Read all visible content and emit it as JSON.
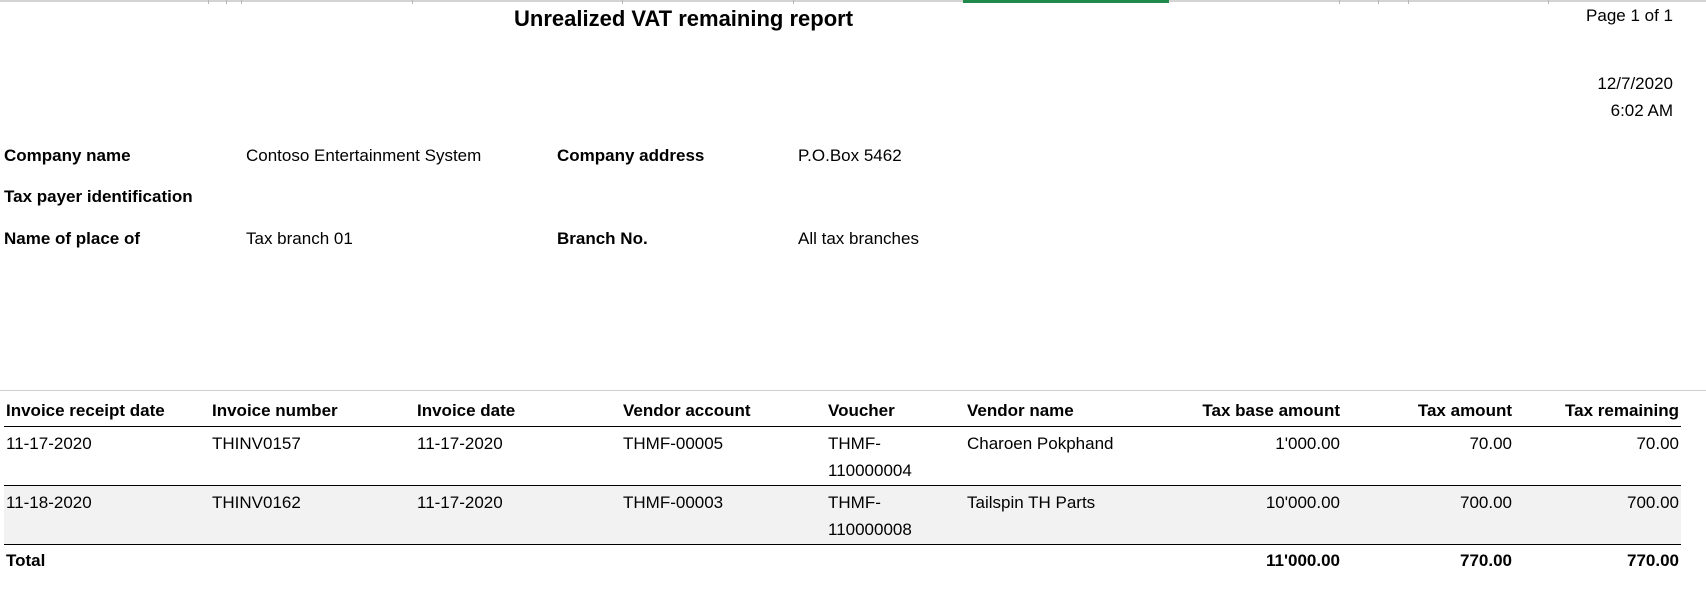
{
  "report": {
    "title": "Unrealized VAT remaining report",
    "page": "Page 1 of 1",
    "date": "12/7/2020",
    "time": "6:02 AM"
  },
  "header": {
    "company_name_label": "Company name",
    "company_name": "Contoso Entertainment System",
    "company_address_label": "Company address",
    "company_address": "P.O.Box 5462",
    "tax_payer_label": "Tax payer identification",
    "place_label": "Name of place of",
    "place": "Tax branch 01",
    "branch_label": "Branch No.",
    "branch": "All tax branches"
  },
  "table": {
    "columns": [
      "Invoice receipt date",
      "Invoice number",
      "Invoice date",
      "Vendor account",
      "Voucher",
      "Vendor name",
      "Tax base amount",
      "Tax amount",
      "Tax remaining"
    ],
    "rows": [
      [
        "11-17-2020",
        "THINV0157",
        "11-17-2020",
        "THMF-00005",
        "THMF-110000004",
        "Charoen Pokphand",
        "1'000.00",
        "70.00",
        "70.00"
      ],
      [
        "11-18-2020",
        "THINV0162",
        "11-17-2020",
        "THMF-00003",
        "THMF-110000008",
        "Tailspin TH Parts",
        "10'000.00",
        "700.00",
        "700.00"
      ]
    ],
    "total": {
      "label": "Total",
      "tax_base_amount": "11'000.00",
      "tax_amount": "770.00",
      "tax_remaining": "770.00"
    }
  },
  "colors": {
    "accent": "#1f8a4c",
    "row_alt": "#f2f2f2"
  }
}
